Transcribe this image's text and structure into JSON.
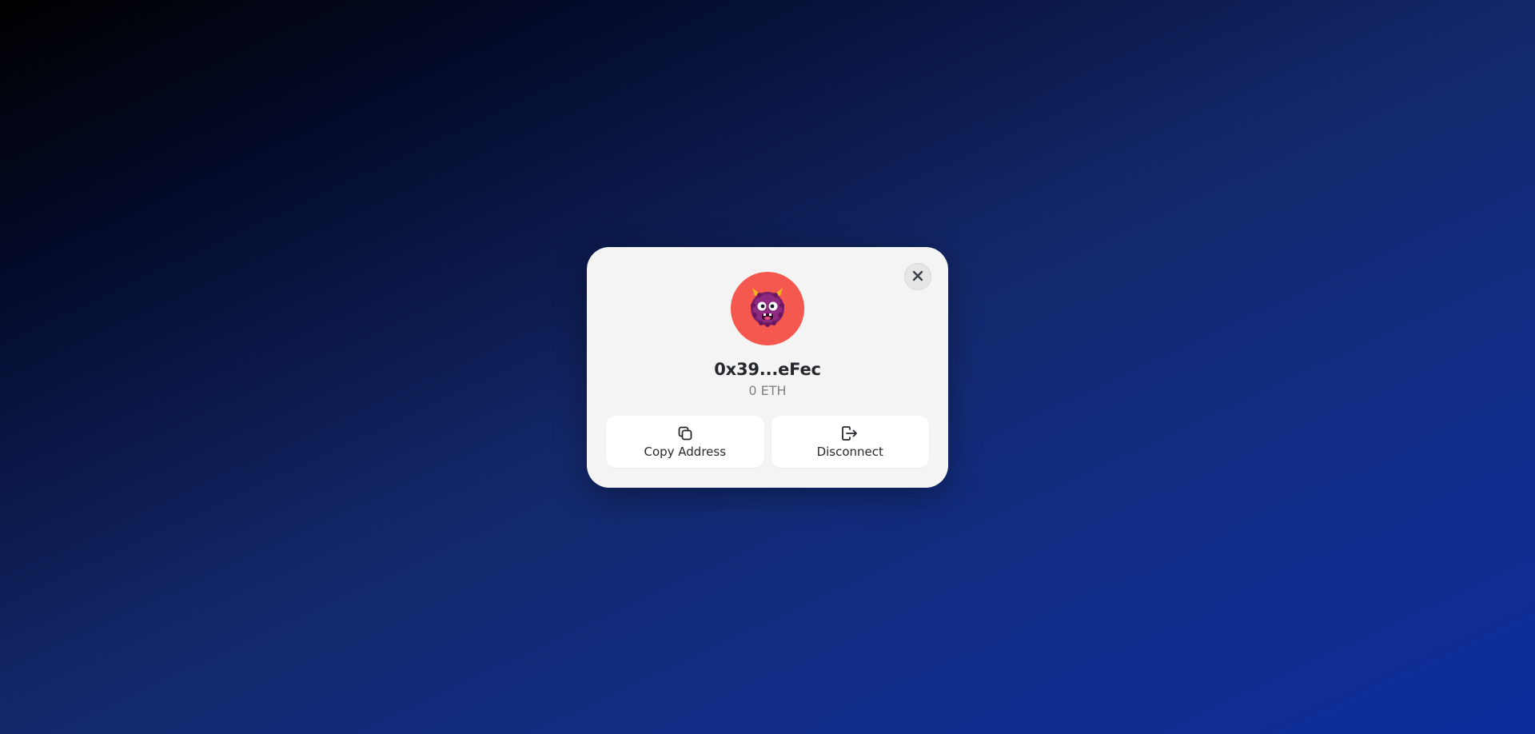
{
  "modal": {
    "address": "0x39...eFec",
    "balance": "0 ETH",
    "avatar_emoji": "monster-avatar",
    "avatar_color": "#f5584f",
    "close_icon": "close-icon",
    "actions": [
      {
        "label": "Copy Address",
        "icon": "copy-icon"
      },
      {
        "label": "Disconnect",
        "icon": "disconnect-icon"
      }
    ]
  },
  "colors": {
    "modal_background": "#f4f4f4",
    "text_primary": "#25292e",
    "text_secondary": "#7f8287"
  }
}
